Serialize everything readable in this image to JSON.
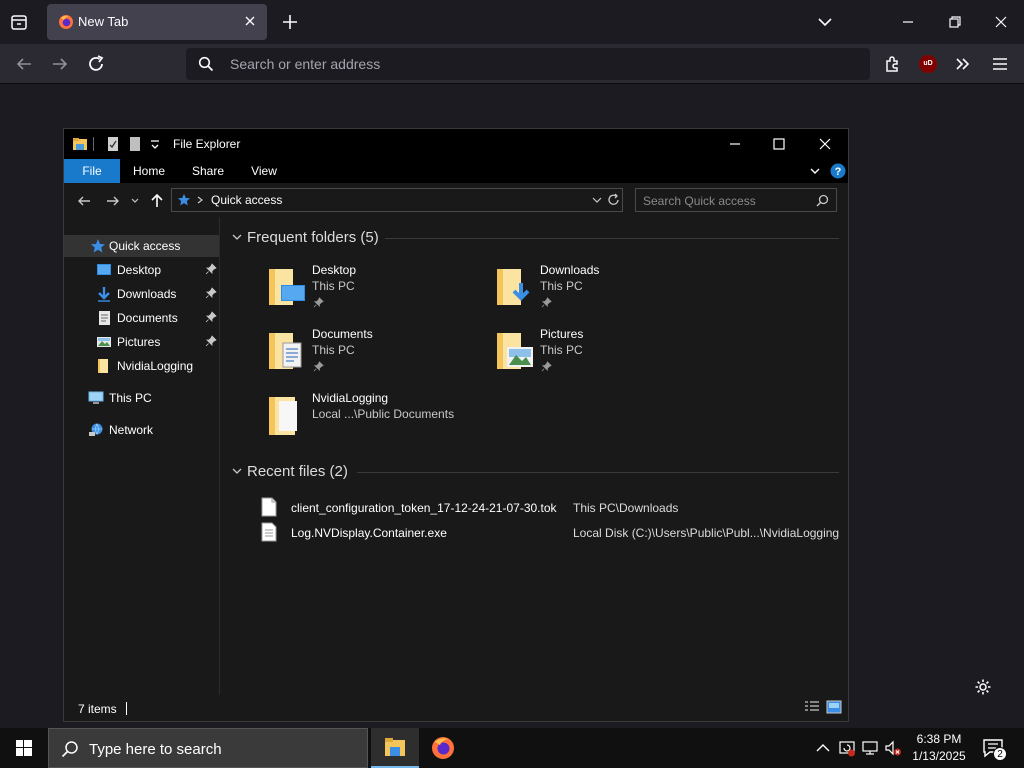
{
  "browser": {
    "tab_title": "New Tab",
    "url_placeholder": "Search or enter address",
    "ublock_label": "uD"
  },
  "explorer": {
    "title": "File Explorer",
    "ribbon_tabs": [
      "File",
      "Home",
      "Share",
      "View"
    ],
    "address_location": "Quick access",
    "search_placeholder": "Search Quick access",
    "nav": {
      "quick_access": "Quick access",
      "pinned": [
        "Desktop",
        "Downloads",
        "Documents",
        "Pictures"
      ],
      "unpinned": "NvidiaLogging",
      "this_pc": "This PC",
      "network": "Network"
    },
    "frequent_header": "Frequent folders (5)",
    "frequent_folders": [
      {
        "name": "Desktop",
        "location": "This PC",
        "icon": "desktop-folder"
      },
      {
        "name": "Downloads",
        "location": "This PC",
        "icon": "downloads-folder"
      },
      {
        "name": "Documents",
        "location": "This PC",
        "icon": "documents-folder"
      },
      {
        "name": "Pictures",
        "location": "This PC",
        "icon": "pictures-folder"
      },
      {
        "name": "NvidiaLogging",
        "location": "Local ...\\Public Documents",
        "icon": "plain-folder"
      }
    ],
    "recent_header": "Recent files (2)",
    "recent_files": [
      {
        "name": "client_configuration_token_17-12-24-21-07-30.tok",
        "path": "This PC\\Downloads"
      },
      {
        "name": "Log.NVDisplay.Container.exe",
        "path": "Local Disk (C:)\\Users\\Public\\Publ...\\NvidiaLogging"
      }
    ],
    "status_count": "7 items"
  },
  "taskbar": {
    "search_text": "Type here to search",
    "time": "6:38 PM",
    "date": "1/13/2025",
    "notification_count": "2"
  },
  "colors": {
    "accent": "#1979ca",
    "folder_yellow": "#f4c55a",
    "firefox_orange": "#ff7139"
  }
}
